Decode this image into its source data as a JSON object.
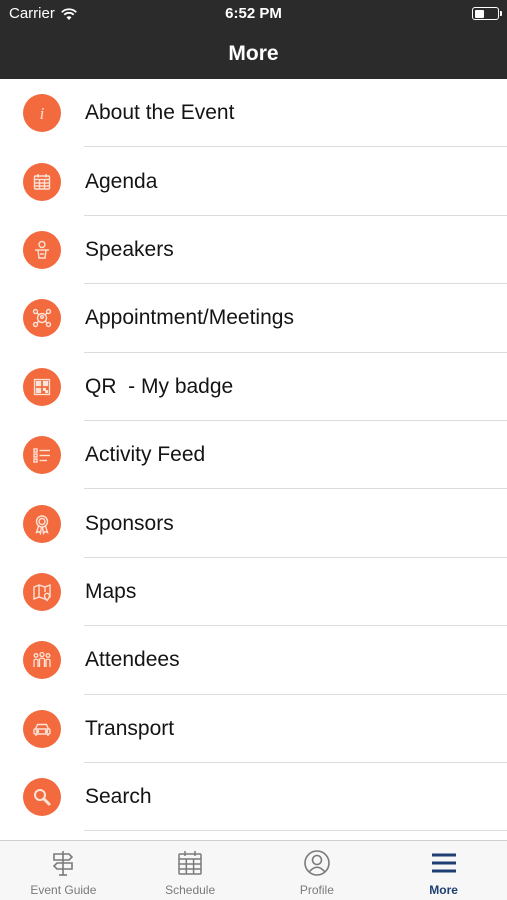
{
  "status_bar": {
    "carrier": "Carrier",
    "time": "6:52 PM"
  },
  "nav": {
    "title": "More"
  },
  "menu": {
    "items": [
      {
        "label": "About the Event",
        "icon": "info-icon"
      },
      {
        "label": "Agenda",
        "icon": "calendar-icon"
      },
      {
        "label": "Speakers",
        "icon": "speaker-podium-icon"
      },
      {
        "label": "Appointment/Meetings",
        "icon": "meeting-network-icon"
      },
      {
        "label": "QR  - My badge",
        "icon": "qr-code-icon"
      },
      {
        "label": "Activity Feed",
        "icon": "feed-list-icon"
      },
      {
        "label": "Sponsors",
        "icon": "award-ribbon-icon"
      },
      {
        "label": "Maps",
        "icon": "map-pin-icon"
      },
      {
        "label": "Attendees",
        "icon": "people-group-icon"
      },
      {
        "label": "Transport",
        "icon": "car-icon"
      },
      {
        "label": "Search",
        "icon": "search-icon"
      }
    ]
  },
  "tabs": [
    {
      "label": "Event Guide",
      "icon": "signpost-icon",
      "active": false
    },
    {
      "label": "Schedule",
      "icon": "calendar-icon",
      "active": false
    },
    {
      "label": "Profile",
      "icon": "user-profile-icon",
      "active": false
    },
    {
      "label": "More",
      "icon": "hamburger-menu-icon",
      "active": true
    }
  ],
  "colors": {
    "accent": "#f26a3d",
    "header_bg": "#2b2b2b",
    "tab_active": "#1f3f73",
    "tab_inactive": "#7a7a7a"
  }
}
